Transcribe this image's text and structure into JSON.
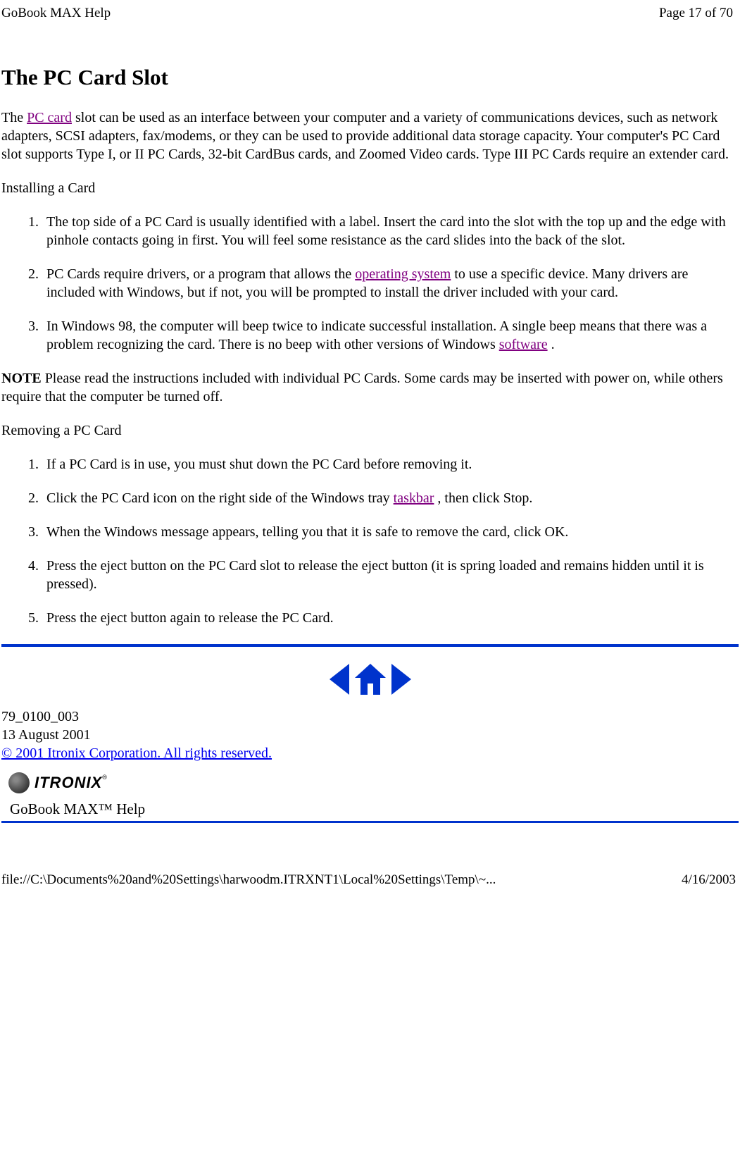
{
  "header": {
    "title": "GoBook MAX Help",
    "page_indicator": "Page 17 of 70"
  },
  "main": {
    "heading": "The PC Card Slot",
    "intro": {
      "pre": "The ",
      "link": "PC card",
      "post": " slot can be used as an interface between your computer and a variety of communications devices, such as network adapters, SCSI adapters, fax/modems, or they can be used to provide additional data storage capacity. Your computer's PC Card slot supports Type I, or II PC Cards, 32-bit CardBus cards, and Zoomed Video cards.  Type III PC Cards require an extender card."
    },
    "installing_label": "Installing a Card",
    "installing_steps": {
      "s1": "The top side of a PC Card is usually identified with a label. Insert the card into the slot with the top up and the edge with pinhole contacts going in first. You will feel some resistance as the card slides into the back of the slot.",
      "s2_pre": "PC Cards require drivers, or a program that allows the ",
      "s2_link": "operating system",
      "s2_post": " to use a specific device. Many drivers are included with Windows, but if not, you will be prompted to install the driver included with your card.",
      "s3_pre": "In Windows 98, the computer will beep twice to indicate successful installation. A single beep means that there was a problem recognizing the card.  There is no beep with other versions of Windows ",
      "s3_link": "software",
      "s3_post": " ."
    },
    "note_label": "NOTE",
    "note_text": "  Please read the instructions included with individual PC Cards. Some cards may be inserted with power on, while others require that the computer be turned off.",
    "removing_label": "Removing a PC Card",
    "removing_steps": {
      "s1": "If a PC Card is in use, you must shut down the PC Card before removing it.",
      "s2_pre": "Click the PC Card icon on the right side of the Windows tray ",
      "s2_link": "taskbar",
      "s2_post": " , then click Stop.",
      "s3": "When the Windows message appears, telling you that it is safe to remove the card, click OK.",
      "s4": "Press the eject button on the PC Card slot to release the eject button (it is spring loaded and remains hidden until it is pressed).",
      "s5": "Press the eject button again to release the PC Card."
    }
  },
  "footer_block": {
    "doc_id": "79_0100_003",
    "doc_date": "13 August 2001",
    "copyright": "© 2001 Itronix Corporation.  All rights reserved.",
    "logo_text": "ITRONIX",
    "help_title": "GoBook MAX™ Help"
  },
  "footer": {
    "path": "file://C:\\Documents%20and%20Settings\\harwoodm.ITRXNT1\\Local%20Settings\\Temp\\~...",
    "date": "4/16/2003"
  }
}
